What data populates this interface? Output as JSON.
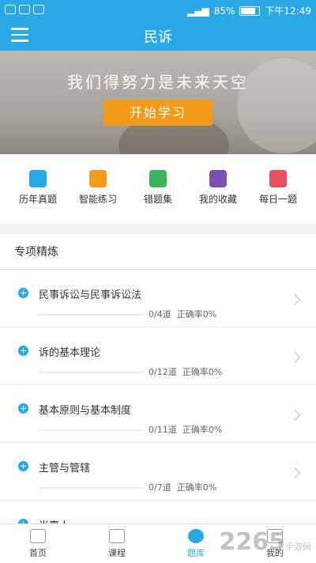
{
  "status_bar": {
    "battery": "85%",
    "battery_level": 0.85,
    "time": "下午12:49"
  },
  "nav": {
    "title": "民诉"
  },
  "banner": {
    "text": "我们得努力是未来天空",
    "button": "开始学习"
  },
  "quick_links": [
    {
      "label": "历年真题",
      "icon": "document-list-icon",
      "color": "#29a8e6"
    },
    {
      "label": "智能练习",
      "icon": "lightbulb-icon",
      "color": "#f39a1b"
    },
    {
      "label": "错题集",
      "icon": "wrong-book-icon",
      "color": "#3bb45a"
    },
    {
      "label": "我的收藏",
      "icon": "star-icon",
      "color": "#7b4fb3"
    },
    {
      "label": "每日一题",
      "icon": "calendar-icon",
      "color": "#e8505b"
    }
  ],
  "section": {
    "title": "专项精炼"
  },
  "topics": [
    {
      "name": "民事诉讼与民事诉讼法",
      "count": "0/4道",
      "accuracy": "正确率0%",
      "progress": 0
    },
    {
      "name": "诉的基本理论",
      "count": "0/12道",
      "accuracy": "正确率0%",
      "progress": 0
    },
    {
      "name": "基本原则与基本制度",
      "count": "0/11道",
      "accuracy": "正确率0%",
      "progress": 0
    },
    {
      "name": "主管与管辖",
      "count": "0/7道",
      "accuracy": "正确率0%",
      "progress": 0
    },
    {
      "name": "当事人",
      "count": "",
      "accuracy": "",
      "progress": 0
    }
  ],
  "tabs": [
    {
      "label": "首页",
      "icon": "home-icon",
      "active": false
    },
    {
      "label": "课程",
      "icon": "video-icon",
      "active": false
    },
    {
      "label": "题库",
      "icon": "question-bank-icon",
      "active": true
    },
    {
      "label": "我的",
      "icon": "profile-icon",
      "active": false
    }
  ],
  "colors": {
    "primary": "#29a8e6",
    "accent": "#f39a1b"
  },
  "watermark": {
    "text": "2265",
    "sub": "手游网"
  }
}
